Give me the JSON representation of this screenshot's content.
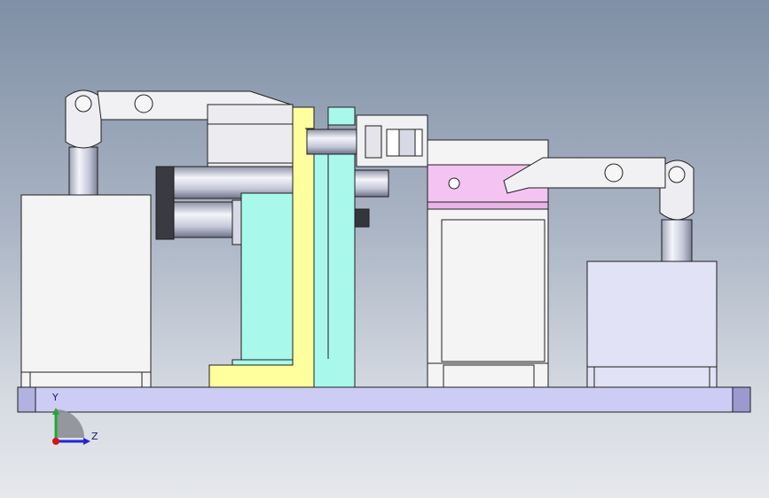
{
  "viewport": {
    "background": [
      "#7f8fa5",
      "#e6e8ec"
    ]
  },
  "colors": {
    "base_plate": "#ccccf4",
    "left_block": "#f4f4f4",
    "right_block": "#e2e2f6",
    "bracket_yellow": "#ffff9e",
    "support_cyan": "#a8f9ec",
    "clamp_pink": "#f5c3f2",
    "steel": "#dcdde6",
    "dark_steel": "#35353c",
    "edge": "#1f1f1f"
  },
  "triad": {
    "y_label": "Y",
    "z_label": "Z",
    "y_color": "#1faa2e",
    "z_color": "#2323d8",
    "x_color": "#d01616"
  }
}
